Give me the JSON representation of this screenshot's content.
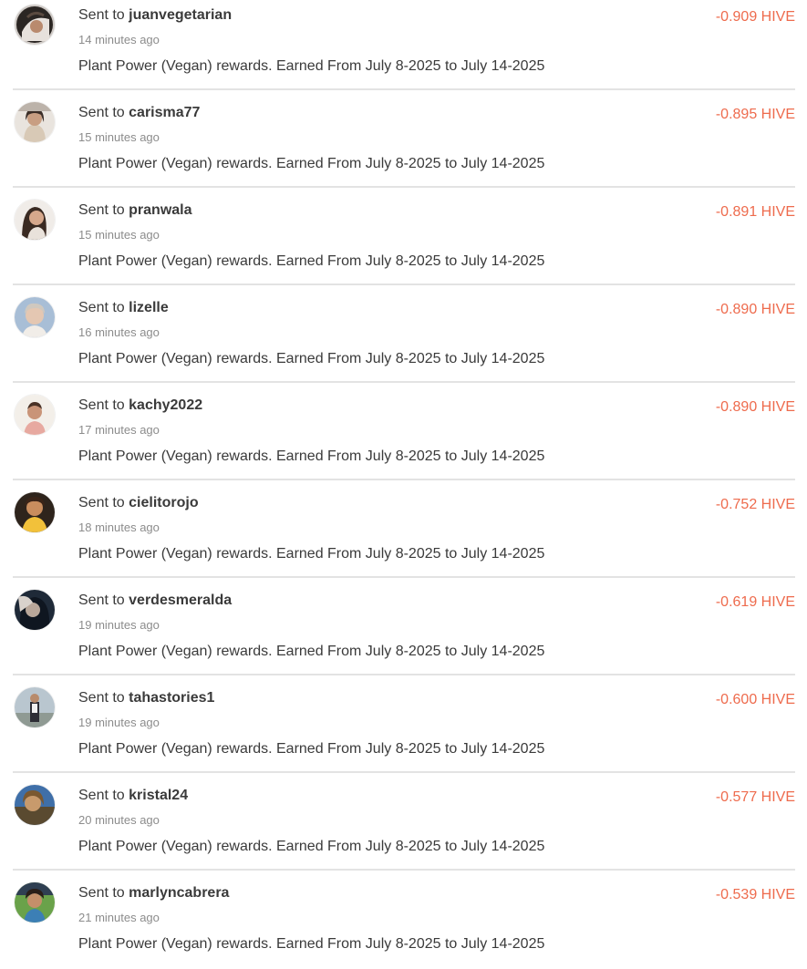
{
  "sent_prefix": "Sent to",
  "accent_color": "#ee6b4d",
  "transactions": [
    {
      "recipient": "juanvegetarian",
      "time_ago": "14 minutes ago",
      "memo": "Plant Power (Vegan) rewards. Earned From July 8-2025 to July 14-2025",
      "amount": "-0.909 HIVE"
    },
    {
      "recipient": "carisma77",
      "time_ago": "15 minutes ago",
      "memo": "Plant Power (Vegan) rewards. Earned From July 8-2025 to July 14-2025",
      "amount": "-0.895 HIVE"
    },
    {
      "recipient": "pranwala",
      "time_ago": "15 minutes ago",
      "memo": "Plant Power (Vegan) rewards. Earned From July 8-2025 to July 14-2025",
      "amount": "-0.891 HIVE"
    },
    {
      "recipient": "lizelle",
      "time_ago": "16 minutes ago",
      "memo": "Plant Power (Vegan) rewards. Earned From July 8-2025 to July 14-2025",
      "amount": "-0.890 HIVE"
    },
    {
      "recipient": "kachy2022",
      "time_ago": "17 minutes ago",
      "memo": "Plant Power (Vegan) rewards. Earned From July 8-2025 to July 14-2025",
      "amount": "-0.890 HIVE"
    },
    {
      "recipient": "cielitorojo",
      "time_ago": "18 minutes ago",
      "memo": "Plant Power (Vegan) rewards. Earned From July 8-2025 to July 14-2025",
      "amount": "-0.752 HIVE"
    },
    {
      "recipient": "verdesmeralda",
      "time_ago": "19 minutes ago",
      "memo": "Plant Power (Vegan) rewards. Earned From July 8-2025 to July 14-2025",
      "amount": "-0.619 HIVE"
    },
    {
      "recipient": "tahastories1",
      "time_ago": "19 minutes ago",
      "memo": "Plant Power (Vegan) rewards. Earned From July 8-2025 to July 14-2025",
      "amount": "-0.600 HIVE"
    },
    {
      "recipient": "kristal24",
      "time_ago": "20 minutes ago",
      "memo": "Plant Power (Vegan) rewards. Earned From July 8-2025 to July 14-2025",
      "amount": "-0.577 HIVE"
    },
    {
      "recipient": "marlyncabrera",
      "time_ago": "21 minutes ago",
      "memo": "Plant Power (Vegan) rewards. Earned From July 8-2025 to July 14-2025",
      "amount": "-0.539 HIVE"
    }
  ]
}
